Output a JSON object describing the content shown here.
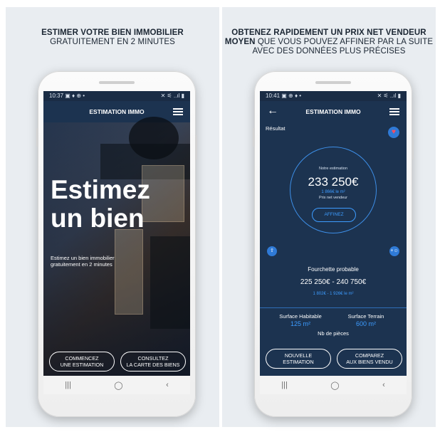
{
  "left_panel": {
    "caption_line1": "ESTIMER VOTRE BIEN IMMOBILIER",
    "caption_line2": "GRATUITEMENT EN 2 MINUTES",
    "status": {
      "time": "10:37",
      "left_icons": "▣ ♦ ⊕ •",
      "right_icons": "✕ ⚟ ..ıl ▮"
    },
    "app_title": "ESTIMATION IMMO",
    "hero_title_line1": "Estimez",
    "hero_title_line2": "un bien",
    "hero_sub_line1": "Estimez un bien immobilier",
    "hero_sub_line2": "gratuitement en 2 minutes",
    "btn_start_line1": "COMMENCEZ",
    "btn_start_line2": "UNE ESTIMATION",
    "btn_map_line1": "CONSULTEZ",
    "btn_map_line2": "LA CARTE DES BIENS"
  },
  "right_panel": {
    "caption_line1": "OBTENEZ RAPIDEMENT UN PRIX NET VENDEUR",
    "caption_line2_bold": "MOYEN",
    "caption_line2_rest": " QUE VOUS POUVEZ AFFINER PAR LA SUITE",
    "caption_line3": "AVEC DES DONNÉES PLUS PRÉCISES",
    "status": {
      "time": "10:41",
      "left_icons": "▣ ⊕ ♦ •",
      "right_icons": "✕ ⚟ ..ıl ▮"
    },
    "app_title": "ESTIMATION IMMO",
    "result_label": "Résultat",
    "estimate_label": "Notre estimation",
    "estimate_value": "233 250€",
    "estimate_per_m2": "1 866€ le m²",
    "estimate_net": "Prix net vendeur",
    "refine_button": "AFFINEZ",
    "range_label": "Fourchette probable",
    "range_value": "225 250€ - 240 750€",
    "range_per_m2": "1 802€ - 1 926€ le m²",
    "surface_habitable_label": "Surface Habitable",
    "surface_habitable_value": "125 m²",
    "surface_terrain_label": "Surface Terrain",
    "surface_terrain_value": "600 m²",
    "pieces_label": "Nb de pièces",
    "btn_new_line1": "NOUVELLE",
    "btn_new_line2": "ESTIMATION",
    "btn_compare_line1": "COMPAREZ",
    "btn_compare_line2": "AUX BIENS VENDU"
  },
  "navbar": {
    "recent": "|||",
    "home": "◯",
    "back": "‹"
  },
  "colors": {
    "primary": "#1c3350",
    "accent": "#3d9cff",
    "panel": "#e9edf1"
  }
}
